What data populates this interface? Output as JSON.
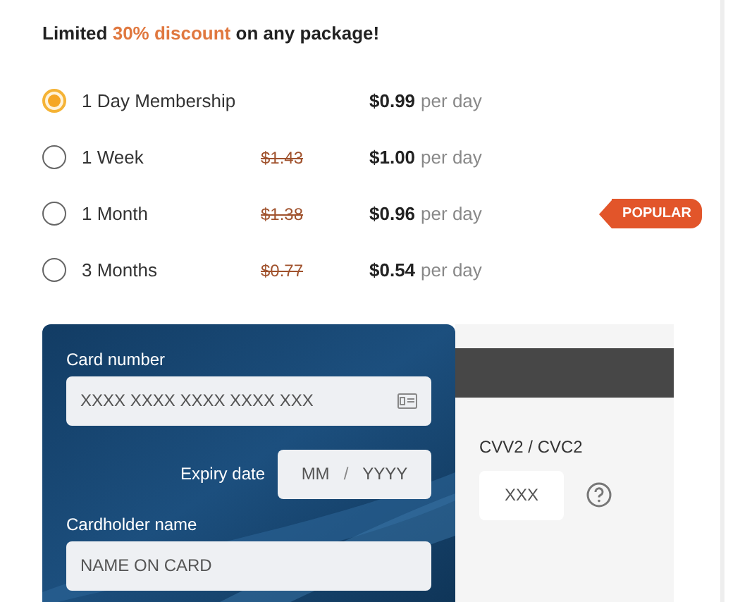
{
  "heading": {
    "before": "Limited ",
    "highlight": "30% discount",
    "after": " on any package!"
  },
  "plans": [
    {
      "label": "1 Day Membership",
      "selected": true,
      "price": "$0.99",
      "unit": "per day"
    },
    {
      "label": "1 Week",
      "selected": false,
      "old_price": "$1.43",
      "price": "$1.00",
      "unit": "per day"
    },
    {
      "label": "1 Month",
      "selected": false,
      "old_price": "$1.38",
      "price": "$0.96",
      "unit": "per day",
      "badge": "POPULAR"
    },
    {
      "label": "3 Months",
      "selected": false,
      "old_price": "$0.77",
      "price": "$0.54",
      "unit": "per day"
    }
  ],
  "card_front": {
    "number_label": "Card number",
    "number_placeholder": "XXXX XXXX XXXX XXXX XXX",
    "expiry_label": "Expiry date",
    "month_placeholder": "MM",
    "separator": "/",
    "year_placeholder": "YYYY",
    "name_label": "Cardholder name",
    "name_placeholder": "NAME ON CARD"
  },
  "card_back": {
    "cvv_label": "CVV2 / CVC2",
    "cvv_placeholder": "XXX"
  }
}
